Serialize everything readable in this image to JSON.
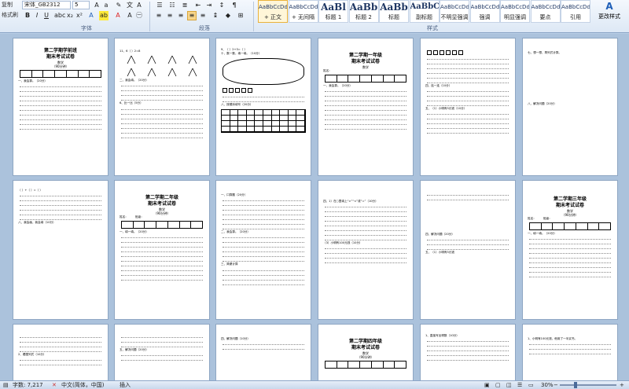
{
  "ribbon": {
    "clipboard_items": [
      "复制",
      "格式刷"
    ],
    "font_name": "宋体_GB2312",
    "font_size": "5",
    "font_group_label": "字体",
    "paragraph_group_label": "段落",
    "styles_group_label": "样式",
    "styles": [
      {
        "sample": "AaBbCcDd",
        "name": "+ 正文",
        "active": true,
        "kind": "small"
      },
      {
        "sample": "AaBbCcDd",
        "name": "+ 无间隔",
        "active": false,
        "kind": "small"
      },
      {
        "sample": "AaBl",
        "name": "标题 1",
        "active": false,
        "kind": "big"
      },
      {
        "sample": "AaBb",
        "name": "标题 2",
        "active": false,
        "kind": "big"
      },
      {
        "sample": "AaBb",
        "name": "标题",
        "active": false,
        "kind": "big"
      },
      {
        "sample": "AaBbC",
        "name": "副标题",
        "active": false,
        "kind": "mid"
      },
      {
        "sample": "AaBbCcDd",
        "name": "不明显强调",
        "active": false,
        "kind": "small"
      },
      {
        "sample": "AaBbCcDd",
        "name": "强调",
        "active": false,
        "kind": "small"
      },
      {
        "sample": "AaBbCcDd",
        "name": "明显强调",
        "active": false,
        "kind": "small"
      },
      {
        "sample": "AaBbCcDd",
        "name": "要点",
        "active": false,
        "kind": "small"
      },
      {
        "sample": "AaBbCcDd",
        "name": "引用",
        "active": false,
        "kind": "small"
      }
    ],
    "change_style_label": "更改样式"
  },
  "pages": {
    "p1": {
      "title1": "第二学期学前班",
      "title2": "期末考试试卷",
      "subject": "数学",
      "time": "（90分钟）",
      "section": "一、我会算。（20分）"
    },
    "p2": {
      "line1": "11、6（   ）2=8",
      "section": "二、我会填。（20分）",
      "line2": "6、比一比（5分）"
    },
    "p3": {
      "line1": "9、（    ）2+3=（    ）",
      "line2": "十、数一数，填一填。（10分）",
      "line3": "八、按顺序填写（20分）"
    },
    "p4": {
      "title1": "第二学期一年级",
      "title2": "期末考试试卷",
      "subject": "数学",
      "name_label": "姓名：",
      "section": "一、我会算。（20分）"
    },
    "p5": {
      "line1": "四、连一连（10分）",
      "line2": "五、（1）小明有5元钱（10分）"
    },
    "p6": {
      "line1": "七、想一想，再列式计算。",
      "line2": "八、解决问题（20分）"
    },
    "p7": {
      "line1": "（  ）+（  ）=（  ）",
      "line2": "八、我会画，我会填（10分）"
    },
    "p8": {
      "title1": "第二学期二年级",
      "title2": "期末考试试卷",
      "subject": "数学",
      "time": "（90分钟）",
      "name_label": "姓名：",
      "class_label": "班级：",
      "section": "一、填一填。（20分）"
    },
    "p9": {
      "line1": "一、口算题（20分）",
      "line2": "二、我会算。（20分）",
      "line3": "三、简便计算"
    },
    "p10": {
      "line1": "四、1）在○里填上“>”“<”或“=”（10分）",
      "line2": "（3）小明有100元钱（10分）"
    },
    "p11": {
      "line1": "四、解决问题（20分）",
      "line2": "五、（1）小明有5元钱"
    },
    "p12": {
      "title1": "第二学期三年级",
      "title2": "期末考试试卷",
      "subject": "数学",
      "time": "（90分钟）",
      "name_label": "姓名：",
      "class_label": "班级：",
      "section": "一、填一填。（20分）"
    },
    "p13": {
      "line1": "2、看图列式（10分）"
    },
    "p14": {
      "line1": "五、解决问题（20分）"
    },
    "p15": {
      "line1": "四、解决问题（10分）"
    },
    "p16": {
      "title1": "第二学期四年级",
      "title2": "期末考试试卷",
      "subject": "数学",
      "time": "（90分钟）"
    },
    "p17": {
      "line1": "1、直接写出得数（10分）"
    },
    "p18": {
      "line1": "1、小明有100元钱，他用了一半买书。"
    }
  },
  "status": {
    "word_count": "字数: 7,217",
    "language": "中文(简体，中国)",
    "mode": "插入",
    "zoom": "30%"
  }
}
